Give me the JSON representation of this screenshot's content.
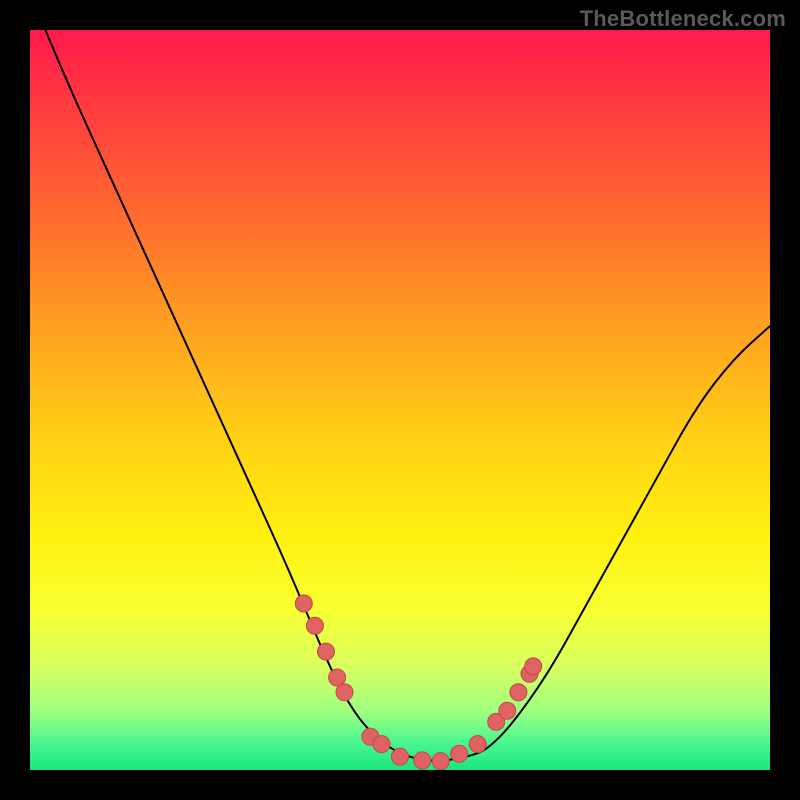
{
  "watermark": "TheBottleneck.com",
  "colors": {
    "background": "#000000",
    "curve_stroke": "#000000",
    "marker_fill": "#e06262",
    "marker_stroke": "#c24848"
  },
  "chart_data": {
    "type": "line",
    "title": "",
    "xlabel": "",
    "ylabel": "",
    "xlim": [
      0,
      1
    ],
    "ylim": [
      0,
      1
    ],
    "x": [
      0.0,
      0.05,
      0.1,
      0.15,
      0.2,
      0.25,
      0.3,
      0.35,
      0.4,
      0.43,
      0.46,
      0.5,
      0.55,
      0.6,
      0.62,
      0.65,
      0.7,
      0.75,
      0.8,
      0.85,
      0.9,
      0.95,
      1.0
    ],
    "values": [
      1.05,
      0.93,
      0.82,
      0.71,
      0.6,
      0.49,
      0.38,
      0.27,
      0.15,
      0.09,
      0.05,
      0.02,
      0.01,
      0.02,
      0.03,
      0.06,
      0.13,
      0.22,
      0.31,
      0.4,
      0.49,
      0.555,
      0.6
    ],
    "markers": {
      "x": [
        0.37,
        0.385,
        0.4,
        0.415,
        0.425,
        0.46,
        0.475,
        0.5,
        0.53,
        0.555,
        0.58,
        0.605,
        0.63,
        0.645,
        0.66,
        0.675,
        0.68
      ],
      "y": [
        0.225,
        0.195,
        0.16,
        0.125,
        0.105,
        0.045,
        0.035,
        0.018,
        0.013,
        0.012,
        0.022,
        0.035,
        0.065,
        0.08,
        0.105,
        0.13,
        0.14
      ]
    }
  }
}
